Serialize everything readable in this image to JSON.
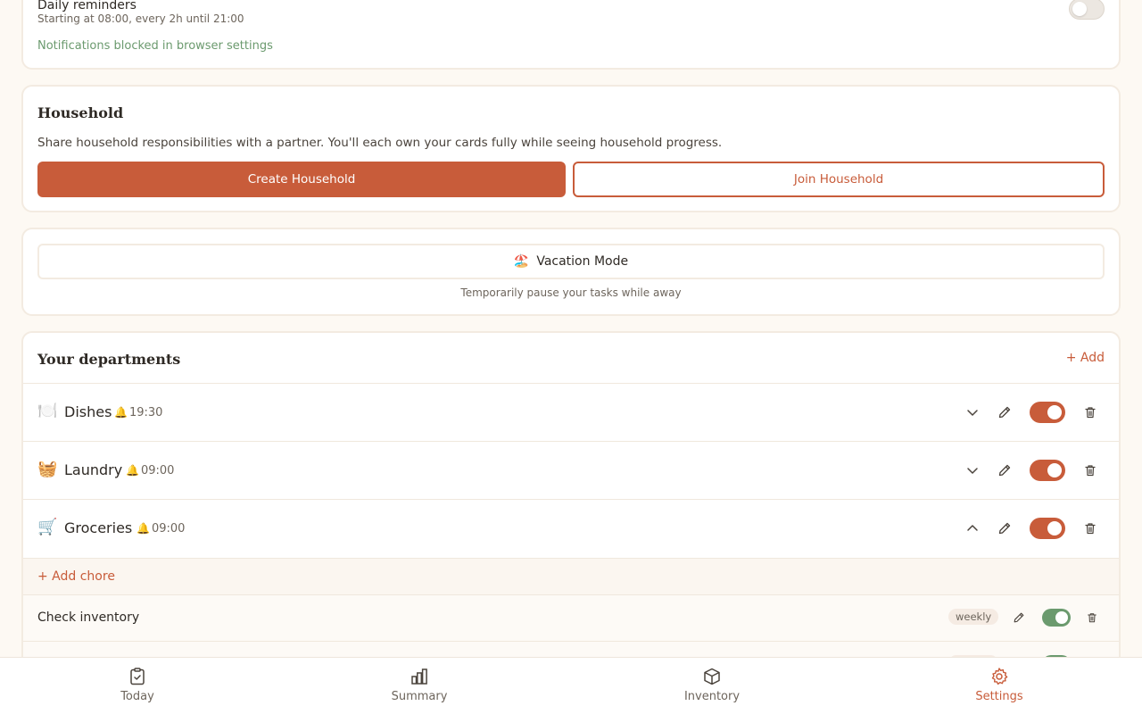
{
  "notifications": {
    "title": "Daily reminders",
    "subtitle": "Starting at 08:00, every 2h until 21:00",
    "blocked_note": "Notifications blocked in browser settings",
    "toggle_on": false
  },
  "household": {
    "title": "Household",
    "description": "Share household responsibilities with a partner. You'll each own your cards fully while seeing household progress.",
    "create_label": "Create Household",
    "join_label": "Join Household"
  },
  "vacation": {
    "icon": "🏖️",
    "label": "Vacation Mode",
    "subtitle": "Temporarily pause your tasks while away"
  },
  "departments": {
    "title": "Your departments",
    "add_label": "+ Add",
    "items": [
      {
        "emoji": "🍽️",
        "name": "Dishes",
        "time": "19:30",
        "expanded": false,
        "enabled": true
      },
      {
        "emoji": "🧺",
        "name": "Laundry",
        "time": "09:00",
        "expanded": false,
        "enabled": true
      },
      {
        "emoji": "🛒",
        "name": "Groceries",
        "time": "09:00",
        "expanded": true,
        "enabled": true
      }
    ],
    "add_chore_label": "+ Add chore",
    "chores": [
      {
        "name": "Check inventory",
        "frequency": "weekly",
        "enabled": true
      }
    ],
    "bell_icon": "🔔"
  },
  "nav": {
    "items": [
      {
        "label": "Today",
        "icon": "clipboard-check-icon",
        "active": false
      },
      {
        "label": "Summary",
        "icon": "bar-chart-icon",
        "active": false
      },
      {
        "label": "Inventory",
        "icon": "box-icon",
        "active": false
      },
      {
        "label": "Settings",
        "icon": "gear-icon",
        "active": true
      }
    ]
  },
  "colors": {
    "accent": "#c85c3a",
    "success": "#6b9a6e",
    "background": "#fdf9f3"
  }
}
